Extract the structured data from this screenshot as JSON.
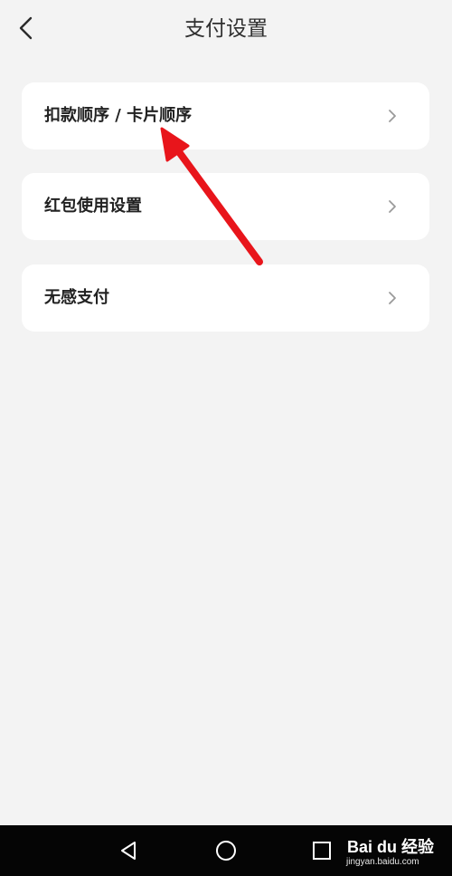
{
  "header": {
    "title": "支付设置",
    "back_icon": "chevron-left-icon"
  },
  "settings": {
    "items": [
      {
        "label": "扣款顺序 / 卡片顺序",
        "icon": "chevron-right-icon"
      },
      {
        "label": "红包使用设置",
        "icon": "chevron-right-icon"
      },
      {
        "label": "无感支付",
        "icon": "chevron-right-icon"
      }
    ]
  },
  "annotation": {
    "type": "red-arrow",
    "color": "#e8151b",
    "points_to": "扣款顺序 / 卡片顺序"
  },
  "navbar": {
    "icons": [
      "triangle-back-icon",
      "circle-home-icon",
      "square-recents-icon"
    ]
  },
  "watermark": {
    "brand_text": "Bai du 经验",
    "url": "jingyan.baidu.com"
  },
  "colors": {
    "background": "#f3f3f3",
    "card": "#ffffff",
    "text": "#222222",
    "navbar": "#050505",
    "arrow": "#e8151b"
  }
}
